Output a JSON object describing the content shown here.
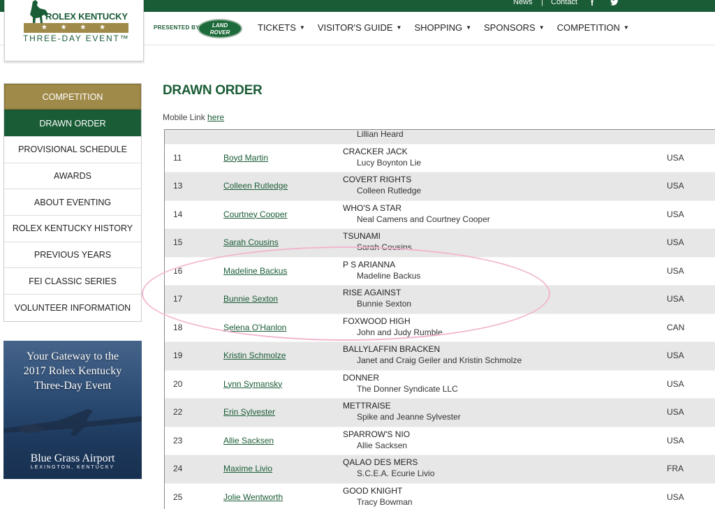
{
  "topbar": {
    "links": [
      "News",
      "Contact"
    ],
    "separator": "|",
    "facebook_icon": "f",
    "twitter_icon": "t"
  },
  "brand": {
    "title": "ROLEX KENTUCKY",
    "stars": "★ ★ ★ ★",
    "subtitle": "THREE-DAY EVENT™",
    "presented_by": "PRESENTED BY",
    "sponsor_badge": "LAND ROVER",
    "colors": {
      "green": "#1a5c36",
      "gold": "#a08a4a"
    }
  },
  "nav": {
    "items": [
      "TICKETS",
      "VISITOR'S GUIDE",
      "SHOPPING",
      "SPONSORS",
      "COMPETITION"
    ],
    "caret": "▼"
  },
  "sidebar": {
    "items": [
      {
        "label": "COMPETITION",
        "state": "section"
      },
      {
        "label": "DRAWN ORDER",
        "state": "active"
      },
      {
        "label": "PROVISIONAL SCHEDULE"
      },
      {
        "label": "AWARDS"
      },
      {
        "label": "ABOUT EVENTING"
      },
      {
        "label": "ROLEX KENTUCKY HISTORY"
      },
      {
        "label": "PREVIOUS YEARS"
      },
      {
        "label": "FEI CLASSIC SERIES"
      },
      {
        "label": "VOLUNTEER INFORMATION"
      }
    ]
  },
  "ad": {
    "headline_1": "Your Gateway to the",
    "headline_2": "2017 Rolex Kentucky",
    "headline_3": "Three-Day Event",
    "airport": "Blue Grass Airport",
    "airport_sub": "LEXINGTON, KENTUCKY"
  },
  "main": {
    "title": "DRAWN ORDER",
    "mobile_prefix": "Mobile Link ",
    "mobile_link": "here"
  },
  "entries": [
    {
      "num": "",
      "rider": "",
      "horse": "",
      "owner": "Lillian Heard",
      "country": ""
    },
    {
      "num": "11",
      "rider": "Boyd Martin",
      "horse": "CRACKER JACK",
      "owner": "Lucy Boynton Lie",
      "country": "USA"
    },
    {
      "num": "13",
      "rider": "Colleen Rutledge",
      "horse": "COVERT RIGHTS",
      "owner": "Colleen Rutledge",
      "country": "USA"
    },
    {
      "num": "14",
      "rider": "Courtney Cooper",
      "horse": "WHO'S A STAR",
      "owner": "Neal Camens and Courtney Cooper",
      "country": "USA"
    },
    {
      "num": "15",
      "rider": "Sarah Cousins",
      "horse": "TSUNAMI",
      "owner": "Sarah Cousins",
      "country": "USA"
    },
    {
      "num": "16",
      "rider": "Madeline Backus",
      "horse": "P S ARIANNA",
      "owner": "Madeline Backus",
      "country": "USA"
    },
    {
      "num": "17",
      "rider": "Bunnie Sexton",
      "horse": "RISE AGAINST",
      "owner": "Bunnie Sexton",
      "country": "USA"
    },
    {
      "num": "18",
      "rider": "Selena O'Hanlon",
      "horse": "FOXWOOD HIGH",
      "owner": "John and Judy Rumble",
      "country": "CAN"
    },
    {
      "num": "19",
      "rider": "Kristin Schmolze",
      "horse": "BALLYLAFFIN BRACKEN",
      "owner": "Janet and Craig Geiler and Kristin Schmolze",
      "country": "USA"
    },
    {
      "num": "20",
      "rider": "Lynn Symansky",
      "horse": "DONNER",
      "owner": "The Donner Syndicate LLC",
      "country": "USA"
    },
    {
      "num": "22",
      "rider": "Erin Sylvester",
      "horse": "METTRAISE",
      "owner": "Spike and Jeanne Sylvester",
      "country": "USA"
    },
    {
      "num": "23",
      "rider": "Allie Sacksen",
      "horse": "SPARROW'S NIO",
      "owner": "Allie Sacksen",
      "country": "USA"
    },
    {
      "num": "24",
      "rider": "Maxime Livio",
      "horse": "QALAO DES MERS",
      "owner": "S.C.E.A. Ecurie Livio",
      "country": "FRA"
    },
    {
      "num": "25",
      "rider": "Jolie Wentworth",
      "horse": "GOOD KNIGHT",
      "owner": "Tracy Bowman",
      "country": "USA"
    }
  ]
}
